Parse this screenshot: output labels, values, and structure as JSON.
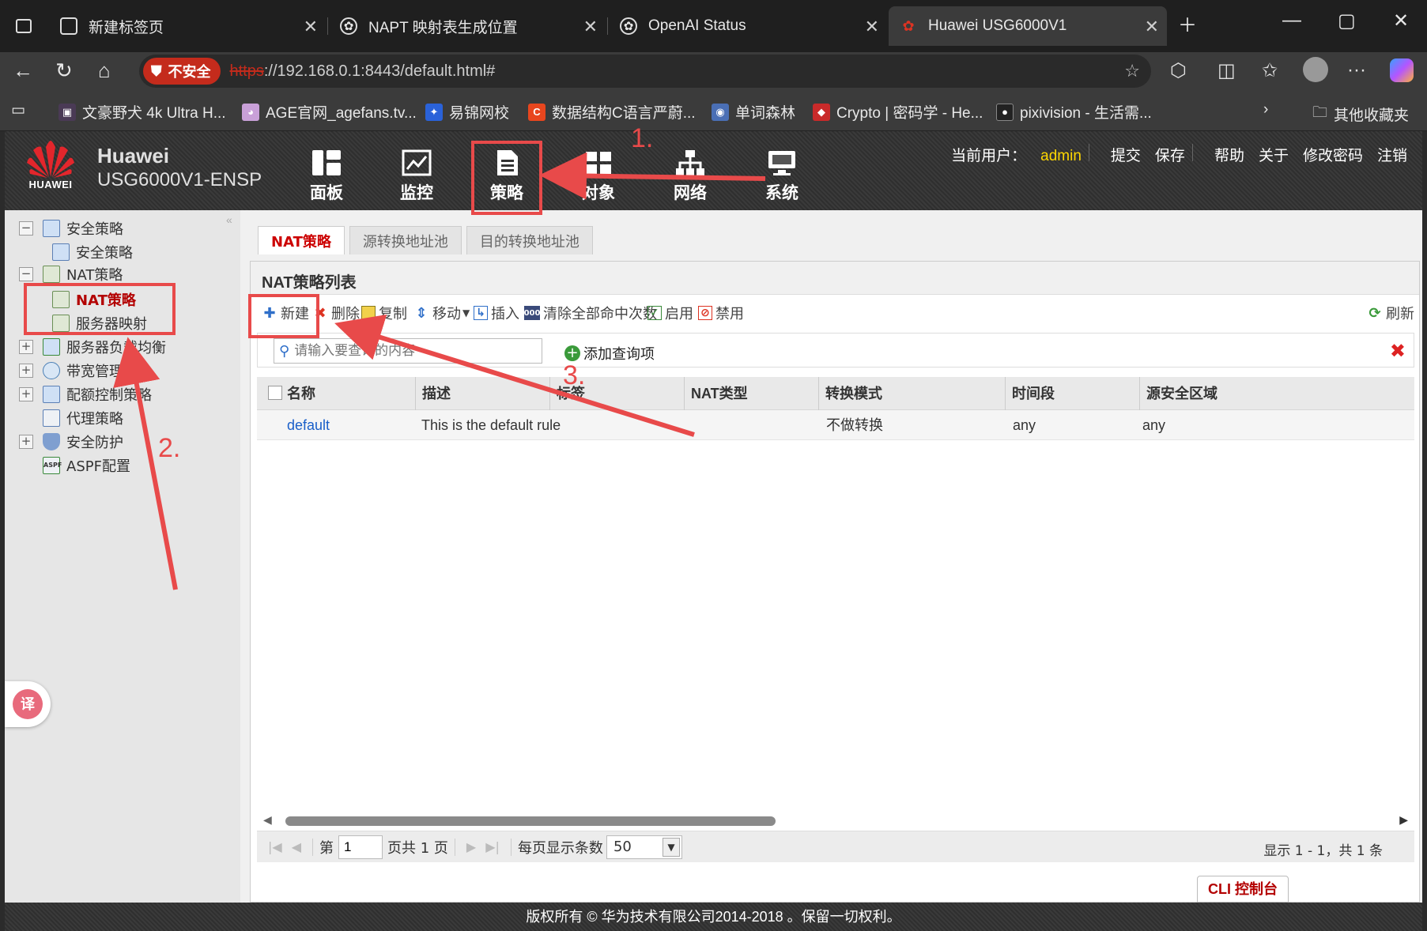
{
  "browser": {
    "tabs": [
      {
        "title": "新建标签页",
        "active": false
      },
      {
        "title": "NAPT 映射表生成位置",
        "active": false
      },
      {
        "title": "OpenAI Status",
        "active": false
      },
      {
        "title": "Huawei USG6000V1",
        "active": true
      }
    ],
    "security_label": "不安全",
    "url_scheme": "https",
    "url_rest": "://192.168.0.1:8443/default.html#",
    "bookmarks": [
      {
        "label": "文豪野犬 4k Ultra H...",
        "color": "#4a3a55"
      },
      {
        "label": "AGE官网_agefans.tv...",
        "color": "#c9a0d8"
      },
      {
        "label": "易锦网校",
        "color": "#2a62d9"
      },
      {
        "label": "数据结构C语言严蔚...",
        "color": "#e8461e"
      },
      {
        "label": "单词森林",
        "color": "#4a6fb5"
      },
      {
        "label": "Crypto | 密码学 - He...",
        "color": "#c92a2a"
      },
      {
        "label": "pixivision - 生活需...",
        "color": "#222"
      }
    ],
    "other_bookmarks": "其他收藏夹"
  },
  "header": {
    "brand_line1": "Huawei",
    "brand_line2": "USG6000V1-ENSP",
    "logo_text": "HUAWEI",
    "nav": [
      {
        "label": "面板",
        "icon": "dashboard-icon"
      },
      {
        "label": "监控",
        "icon": "monitor-icon"
      },
      {
        "label": "策略",
        "icon": "policy-icon"
      },
      {
        "label": "对象",
        "icon": "object-icon"
      },
      {
        "label": "网络",
        "icon": "network-icon"
      },
      {
        "label": "系统",
        "icon": "system-icon"
      }
    ],
    "active_nav": "策略",
    "current_user_label": "当前用户：",
    "current_user": "admin",
    "links": [
      "提交",
      "保存",
      "帮助",
      "关于",
      "修改密码",
      "注销"
    ]
  },
  "tree": {
    "items": [
      {
        "label": "安全策略",
        "level": 0,
        "toggle": "−"
      },
      {
        "label": "安全策略",
        "level": 1
      },
      {
        "label": "NAT策略",
        "level": 0,
        "toggle": "−"
      },
      {
        "label": "NAT策略",
        "level": 1,
        "selected": true
      },
      {
        "label": "服务器映射",
        "level": 1
      },
      {
        "label": "服务器负载均衡",
        "level": 0,
        "toggle": "+"
      },
      {
        "label": "带宽管理",
        "level": 0,
        "toggle": "+"
      },
      {
        "label": "配额控制策略",
        "level": 0,
        "toggle": "+"
      },
      {
        "label": "代理策略",
        "level": 0
      },
      {
        "label": "安全防护",
        "level": 0,
        "toggle": "+"
      },
      {
        "label": "ASPF配置",
        "level": 0
      }
    ]
  },
  "main": {
    "tabs": [
      "NAT策略",
      "源转换地址池",
      "目的转换地址池"
    ],
    "panel_title": "NAT策略列表",
    "toolbar": {
      "new": "新建",
      "delete": "删除",
      "copy": "复制",
      "move": "移动",
      "insert": "插入",
      "clear_hits": "清除全部命中次数",
      "enable": "启用",
      "disable": "禁用",
      "refresh": "刷新"
    },
    "search_placeholder": "请输入要查询的内容",
    "add_query": "添加查询项",
    "columns": [
      "名称",
      "描述",
      "标签",
      "NAT类型",
      "转换模式",
      "时间段",
      "源安全区域"
    ],
    "rows": [
      {
        "name": "default",
        "desc": "This is the default rule",
        "tag": "",
        "nat_type": "",
        "mode": "不做转换",
        "time": "any",
        "src_zone": "any"
      }
    ],
    "pager": {
      "page_prefix": "第",
      "page_value": "1",
      "page_suffix": "页共 1 页",
      "per_page_label": "每页显示条数",
      "per_page": "50",
      "info": "显示 1 - 1，共 1 条"
    },
    "cli_button": "CLI 控制台"
  },
  "footer": "版权所有 © 华为技术有限公司2014-2018 。保留一切权利。",
  "annotations": {
    "n1": "1.",
    "n2": "2.",
    "n3": "3.",
    "color": "#e84a4a"
  }
}
